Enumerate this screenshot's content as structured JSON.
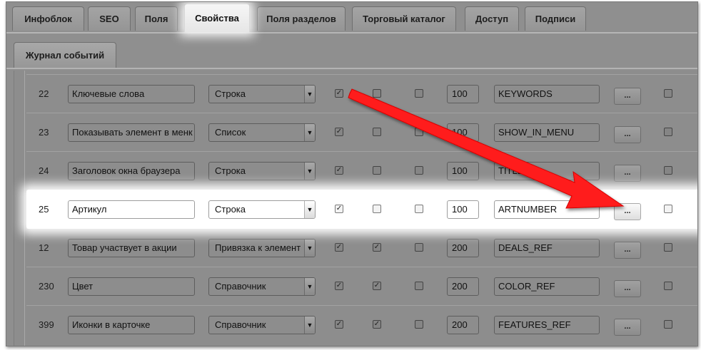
{
  "tabs": [
    "Инфоблок",
    "SEO",
    "Поля",
    "Свойства",
    "Поля разделов",
    "Торговый каталог",
    "Доступ",
    "Подписи"
  ],
  "active_tab": "Свойства",
  "subtab": "Журнал событий",
  "rows": [
    {
      "id": "22",
      "name": "Ключевые слова",
      "type": "Строка",
      "active": true,
      "required": false,
      "multiple": false,
      "sort": "100",
      "code": "KEYWORDS",
      "search": false
    },
    {
      "id": "23",
      "name": "Показывать элемент в менк",
      "type": "Список",
      "active": true,
      "required": false,
      "multiple": false,
      "sort": "100",
      "code": "SHOW_IN_MENU",
      "search": false
    },
    {
      "id": "24",
      "name": "Заголовок окна браузера",
      "type": "Строка",
      "active": true,
      "required": false,
      "multiple": false,
      "sort": "100",
      "code": "TITLE",
      "search": false
    },
    {
      "id": "25",
      "name": "Артикул",
      "type": "Строка",
      "active": true,
      "required": false,
      "multiple": false,
      "sort": "100",
      "code": "ARTNUMBER",
      "search": false
    },
    {
      "id": "12",
      "name": "Товар участвует в акции",
      "type": "Привязка к элемент",
      "active": true,
      "required": true,
      "multiple": false,
      "sort": "200",
      "code": "DEALS_REF",
      "search": false
    },
    {
      "id": "230",
      "name": "Цвет",
      "type": "Справочник",
      "active": true,
      "required": true,
      "multiple": false,
      "sort": "200",
      "code": "COLOR_REF",
      "search": false
    },
    {
      "id": "399",
      "name": "Иконки в карточке",
      "type": "Справочник",
      "active": true,
      "required": true,
      "multiple": false,
      "sort": "200",
      "code": "FEATURES_REF",
      "search": false
    }
  ],
  "highlighted_row": "25",
  "button_label": "...",
  "dropdown_glyph": "▼",
  "check_glyph": "✓",
  "colors": {
    "dim": "#8f8f8f",
    "highlight": "#ffffff",
    "arrow": "#ff0000"
  }
}
